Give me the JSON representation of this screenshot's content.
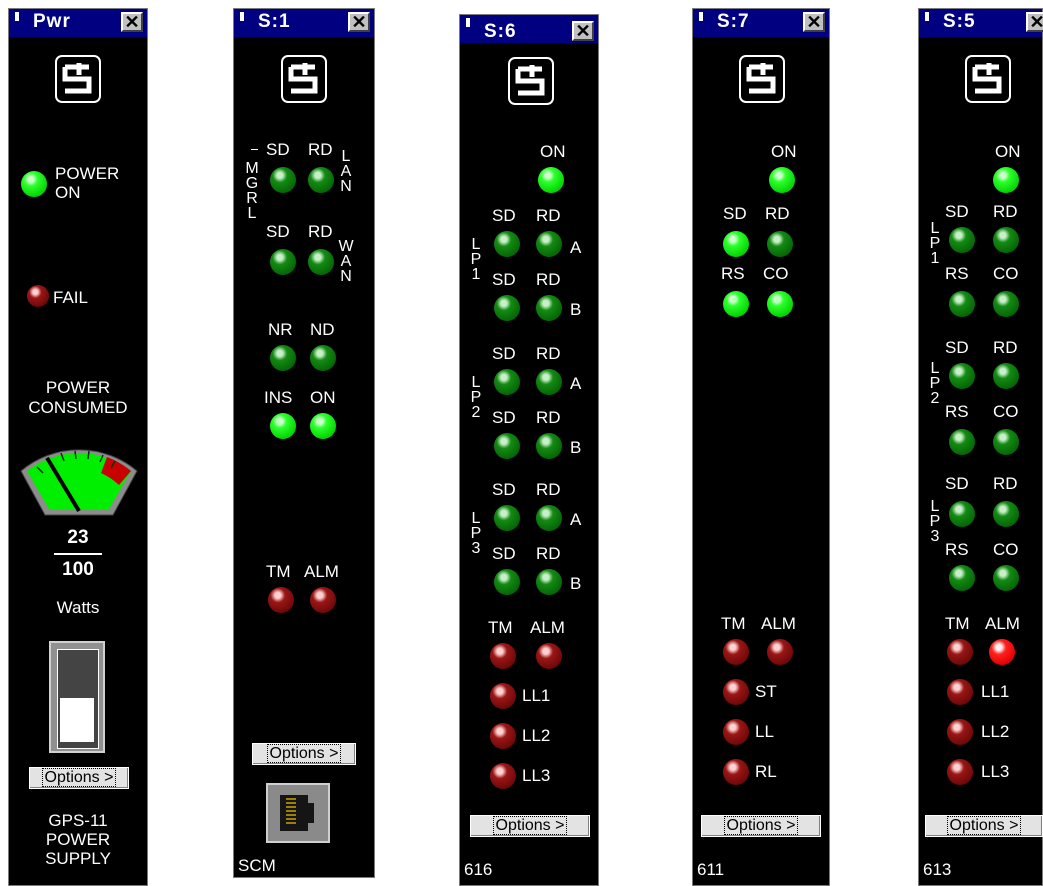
{
  "pwr": {
    "title": "Pwr",
    "close": "✕",
    "power_on_line1": "POWER",
    "power_on_line2": "ON",
    "fail": "FAIL",
    "consumed_line1": "POWER",
    "consumed_line2": "CONSUMED",
    "watts_value": "23",
    "watts_max": "100",
    "watts_unit": "Watts",
    "options": "Options >",
    "desc_line1": "GPS-11",
    "desc_line2": "POWER",
    "desc_line3": "SUPPLY",
    "gauge_fraction": 0.23
  },
  "s1": {
    "title": "S:1",
    "close": "✕",
    "sd1": "SD",
    "rd1": "RD",
    "sd2": "SD",
    "rd2": "RD",
    "mgrl": [
      "M",
      "G",
      "R",
      "L"
    ],
    "lan": [
      "L",
      "A",
      "N"
    ],
    "wan": [
      "W",
      "A",
      "N"
    ],
    "nr": "NR",
    "nd": "ND",
    "ins": "INS",
    "on": "ON",
    "tm": "TM",
    "alm": "ALM",
    "options": "Options >",
    "footer": "SCM"
  },
  "s6": {
    "title": "S:6",
    "close": "✕",
    "on": "ON",
    "groups": [
      {
        "vert": [
          "L",
          "P",
          "1"
        ],
        "rows": [
          {
            "sd": "SD",
            "rd": "RD",
            "side": "A"
          },
          {
            "sd": "SD",
            "rd": "RD",
            "side": "B"
          }
        ]
      },
      {
        "vert": [
          "L",
          "P",
          "2"
        ],
        "rows": [
          {
            "sd": "SD",
            "rd": "RD",
            "side": "A"
          },
          {
            "sd": "SD",
            "rd": "RD",
            "side": "B"
          }
        ]
      },
      {
        "vert": [
          "L",
          "P",
          "3"
        ],
        "rows": [
          {
            "sd": "SD",
            "rd": "RD",
            "side": "A"
          },
          {
            "sd": "SD",
            "rd": "RD",
            "side": "B"
          }
        ]
      }
    ],
    "tm": "TM",
    "alm": "ALM",
    "ll1": "LL1",
    "ll2": "LL2",
    "ll3": "LL3",
    "options": "Options >",
    "footer": "616"
  },
  "s7": {
    "title": "S:7",
    "close": "✕",
    "on": "ON",
    "sd": "SD",
    "rd": "RD",
    "rs": "RS",
    "co": "CO",
    "tm": "TM",
    "alm": "ALM",
    "st": "ST",
    "ll": "LL",
    "rl": "RL",
    "options": "Options >",
    "footer": "611"
  },
  "s5": {
    "title": "S:5",
    "close": "✕",
    "on": "ON",
    "groups": [
      {
        "vert": [
          "L",
          "P",
          "1"
        ],
        "sd": "SD",
        "rd": "RD",
        "rs": "RS",
        "co": "CO"
      },
      {
        "vert": [
          "L",
          "P",
          "2"
        ],
        "sd": "SD",
        "rd": "RD",
        "rs": "RS",
        "co": "CO"
      },
      {
        "vert": [
          "L",
          "P",
          "3"
        ],
        "sd": "SD",
        "rd": "RD",
        "rs": "RS",
        "co": "CO"
      }
    ],
    "tm": "TM",
    "alm": "ALM",
    "ll1": "LL1",
    "ll2": "LL2",
    "ll3": "LL3",
    "options": "Options >",
    "footer": "613"
  }
}
